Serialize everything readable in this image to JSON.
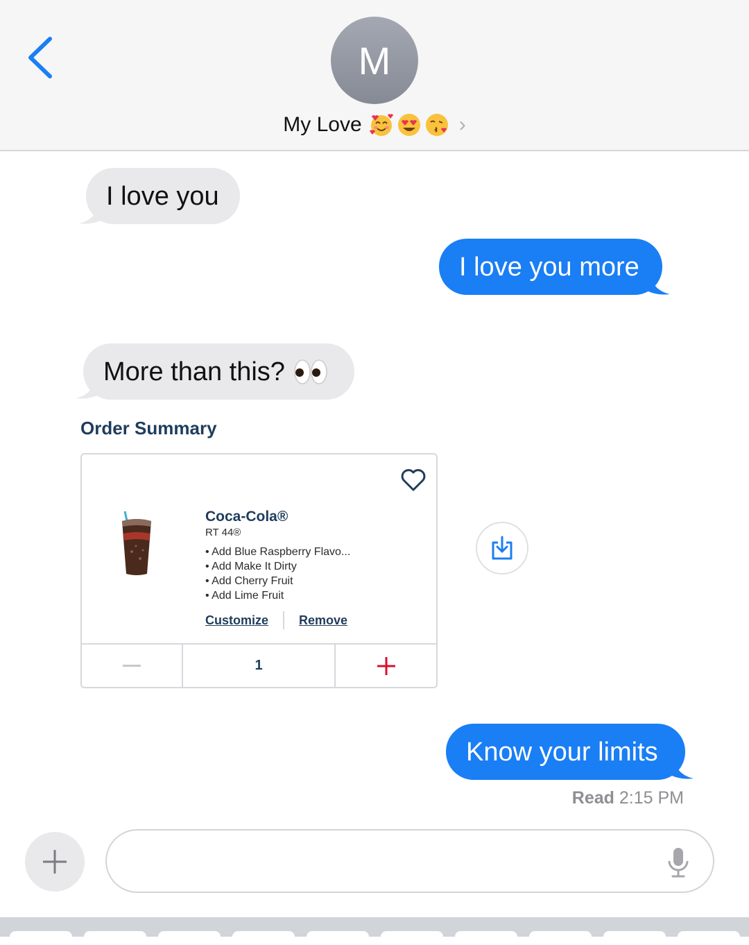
{
  "header": {
    "avatar_initial": "M",
    "contact_name": "My Love",
    "emojis": [
      "smiling-face-with-hearts",
      "heart-eyes",
      "face-blowing-kiss"
    ]
  },
  "messages": [
    {
      "direction": "incoming",
      "text": "I love you"
    },
    {
      "direction": "outgoing",
      "text": "I love you more"
    },
    {
      "direction": "incoming",
      "text": "More than this?",
      "emoji": "eyes"
    },
    {
      "direction": "outgoing",
      "text": "Know your limits"
    }
  ],
  "order": {
    "title": "Order Summary",
    "product_name": "Coca-Cola®",
    "product_size": "RT 44®",
    "modifiers": [
      "• Add Blue Raspberry Flavo...",
      "• Add Make It Dirty",
      "• Add Cherry Fruit",
      "• Add Lime Fruit"
    ],
    "customize_label": "Customize",
    "remove_label": "Remove",
    "quantity": "1"
  },
  "status": {
    "read_label": "Read",
    "read_time": "2:15 PM"
  },
  "composer": {
    "placeholder": ""
  },
  "colors": {
    "ios_blue": "#1a7ef5",
    "incoming_bubble": "#e9e9eb",
    "order_navy": "#1f3d5c",
    "plus_red": "#d6102e"
  }
}
